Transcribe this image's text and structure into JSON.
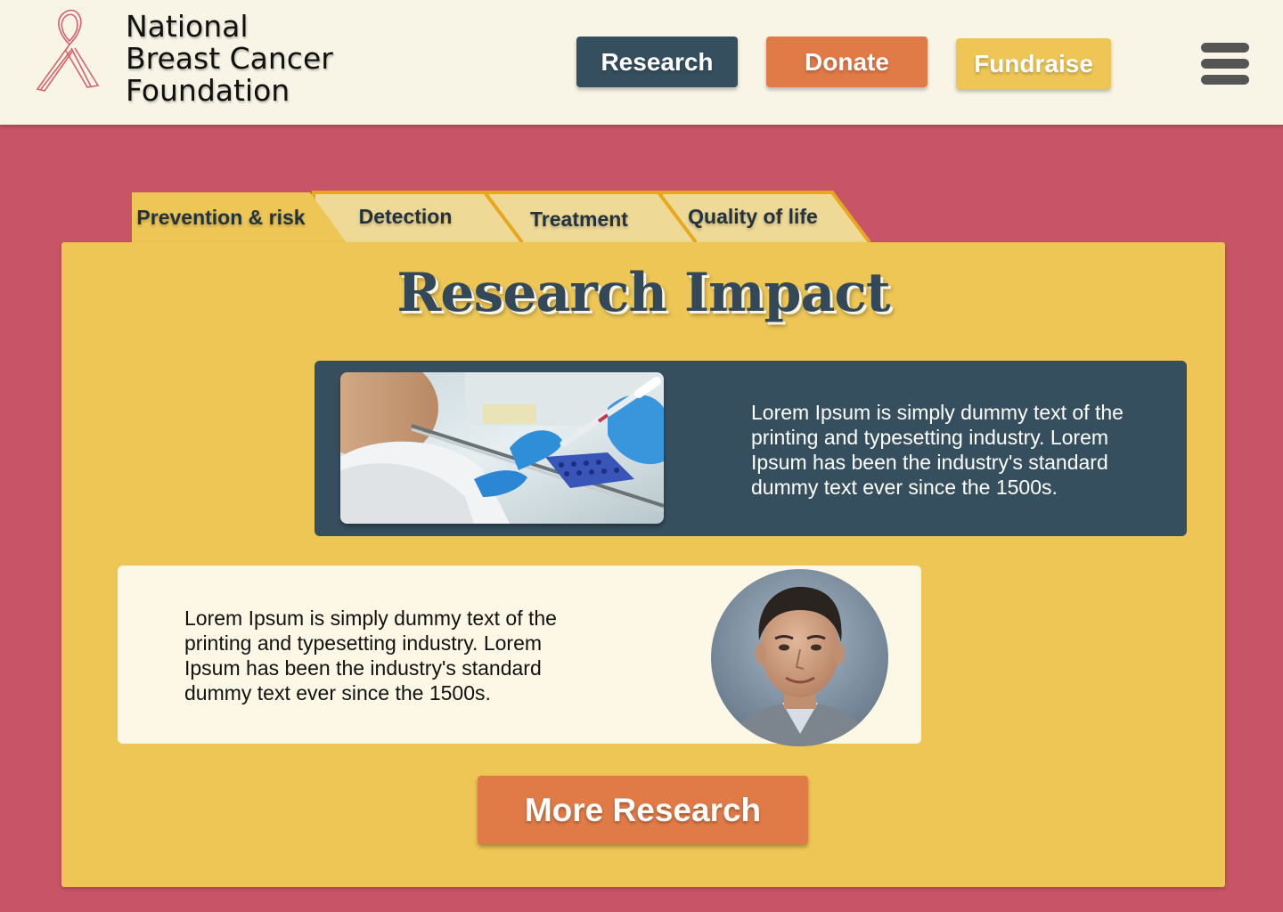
{
  "header": {
    "org_name": [
      "National",
      "Breast Cancer",
      "Foundation"
    ],
    "logo_icon": "pink-ribbon-icon",
    "nav": {
      "research_label": "Research",
      "donate_label": "Donate",
      "fundraise_label": "Fundraise"
    },
    "menu_icon": "hamburger-menu-icon"
  },
  "tabs": [
    {
      "label": "Prevention & risk",
      "active": true
    },
    {
      "label": "Detection",
      "active": false
    },
    {
      "label": "Treatment",
      "active": false
    },
    {
      "label": "Quality of life",
      "active": false
    }
  ],
  "main": {
    "title": "Research Impact",
    "cards": [
      {
        "image": "lab-research-photo",
        "text": "Lorem Ipsum is simply dummy text of the printing and typesetting industry. Lorem Ipsum has been the industry's standard dummy text ever since the 1500s."
      },
      {
        "image": "researcher-portrait-photo",
        "text": "Lorem Ipsum is simply dummy text of the printing and typesetting industry. Lorem Ipsum has been the industry's standard dummy text ever since the 1500s."
      }
    ],
    "more_button_label": "More Research"
  },
  "colors": {
    "page_background": "#c85467",
    "header_background": "#f8f5e7",
    "navy": "#364f5e",
    "orange": "#e07a47",
    "mustard": "#efc655",
    "tab_inactive": "#efd997",
    "tab_border": "#e8a81e",
    "cream_card": "#fdf8e6"
  }
}
